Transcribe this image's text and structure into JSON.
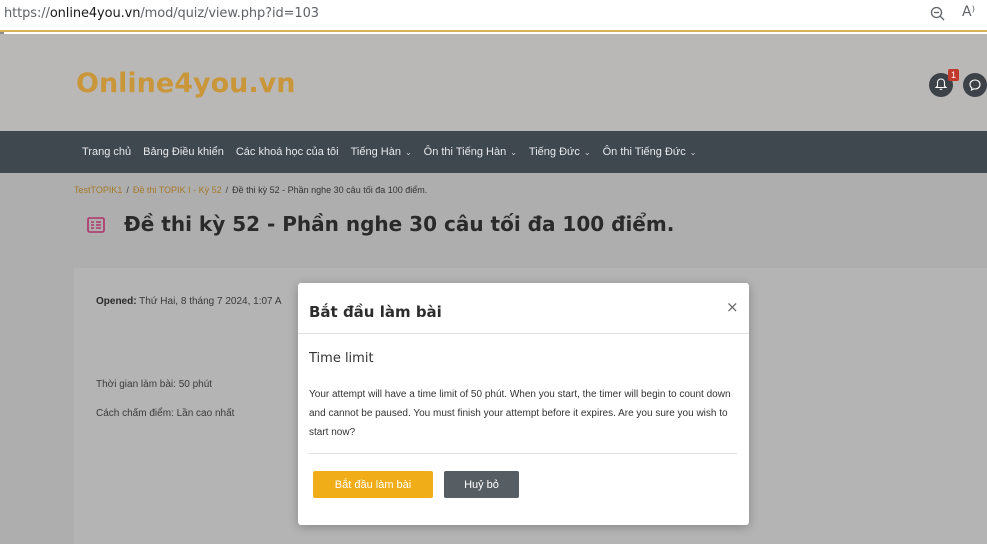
{
  "browser": {
    "url_prefix": "https://",
    "url_host": "online4you.vn",
    "url_path": "/mod/quiz/view.php?id=103",
    "reader_label": "A⁾"
  },
  "header": {
    "logo": "Online4you.vn",
    "notification_count": "1"
  },
  "nav": {
    "items": [
      {
        "label": "Trang chủ",
        "dropdown": false
      },
      {
        "label": "Bảng Điều khiển",
        "dropdown": false
      },
      {
        "label": "Các khoá học của tôi",
        "dropdown": false
      },
      {
        "label": "Tiếng Hàn",
        "dropdown": true
      },
      {
        "label": "Ôn thi Tiếng Hàn",
        "dropdown": true
      },
      {
        "label": "Tiếng Đức",
        "dropdown": true
      },
      {
        "label": "Ôn thi Tiếng Đức",
        "dropdown": true
      }
    ],
    "caret": "⌄"
  },
  "breadcrumb": {
    "items": [
      "TestTOPIK1",
      "Đề thi TOPIK I - Kỳ 52",
      "Đề thi kỳ 52 - Phần nghe 30 câu tối đa 100 điểm."
    ],
    "separator": "/"
  },
  "page": {
    "title": "Đề thi kỳ 52 - Phần nghe 30 câu tối đa 100 điểm.",
    "opened_label": "Opened:",
    "opened_value": " Thứ Hai, 8 tháng 7 2024, 1:07 A",
    "time_limit_info": "Thời gian làm bài: 50 phút",
    "grading_info": "Cách chấm điểm: Lần cao nhất"
  },
  "modal": {
    "title": "Bắt đầu làm bài",
    "close": "×",
    "subtitle": "Time limit",
    "body": "Your attempt will have a time limit of 50 phút. When you start, the timer will begin to count down and cannot be paused. You must finish your attempt before it expires. Are you sure you wish to start now?",
    "start_button": "Bắt đầu làm bài",
    "cancel_button": "Huỷ bỏ"
  }
}
